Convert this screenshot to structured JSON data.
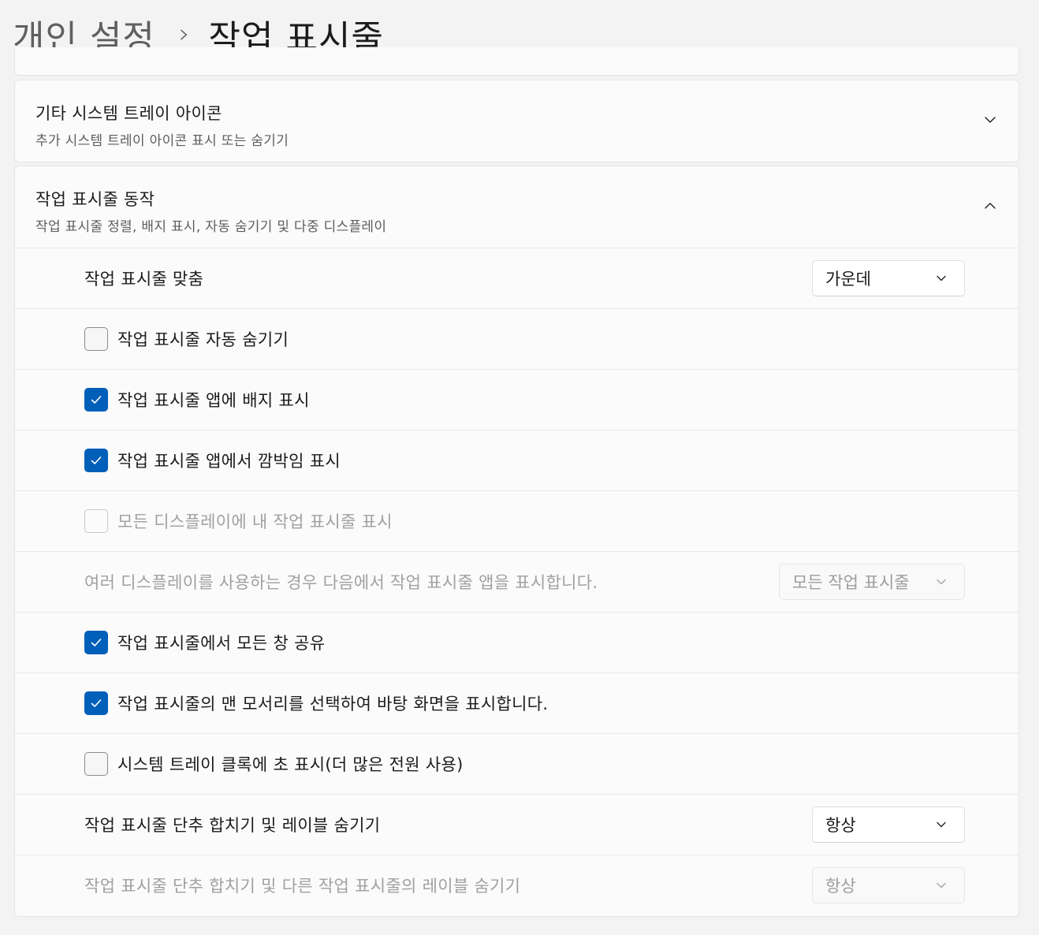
{
  "breadcrumb": {
    "parent": "개인 설정",
    "separator": "›",
    "current": "작업 표시줄"
  },
  "tray_expander": {
    "title": "기타 시스템 트레이 아이콘",
    "subtitle": "추가 시스템 트레이 아이콘 표시 또는 숨기기",
    "expanded": false
  },
  "behaviors_expander": {
    "title": "작업 표시줄 동작",
    "subtitle": "작업 표시줄 정렬, 배지 표시, 자동 숨기기 및 다중 디스플레이",
    "expanded": true
  },
  "settings": {
    "alignment": {
      "label": "작업 표시줄 맞춤",
      "value": "가운데"
    },
    "auto_hide": {
      "label": "작업 표시줄 자동 숨기기",
      "checked": false,
      "disabled": false
    },
    "badges": {
      "label": "작업 표시줄 앱에 배지 표시",
      "checked": true,
      "disabled": false
    },
    "flashing": {
      "label": "작업 표시줄 앱에서 깜박임 표시",
      "checked": true,
      "disabled": false
    },
    "all_displays": {
      "label": "모든 디스플레이에 내 작업 표시줄 표시",
      "checked": false,
      "disabled": true
    },
    "multi_display": {
      "label": "여러 디스플레이를 사용하는 경우 다음에서 작업 표시줄 앱을 표시합니다.",
      "value": "모든 작업 표시줄",
      "disabled": true
    },
    "share_windows": {
      "label": "작업 표시줄에서 모든 창 공유",
      "checked": true,
      "disabled": false
    },
    "far_corner": {
      "label": "작업 표시줄의 맨 모서리를 선택하여 바탕 화면을 표시합니다.",
      "checked": true,
      "disabled": false
    },
    "seconds_clock": {
      "label": "시스템 트레이 클록에 초 표시(더 많은 전원 사용)",
      "checked": false,
      "disabled": false
    },
    "combine_buttons": {
      "label": "작업 표시줄 단추 합치기 및 레이블 숨기기",
      "value": "항상",
      "disabled": false
    },
    "combine_other": {
      "label": "작업 표시줄 단추 합치기 및 다른 작업 표시줄의 레이블 숨기기",
      "value": "항상",
      "disabled": true
    }
  },
  "icons": {
    "expander_collapsed": "chevron-down-icon",
    "expander_expanded": "chevron-up-icon",
    "dropdown": "chevron-down-icon",
    "check": "checkmark-icon"
  },
  "colors": {
    "accent": "#005fb8",
    "background": "#f3f3f3",
    "card": "#fbfbfb",
    "disabled_text": "#a0a0a0"
  }
}
